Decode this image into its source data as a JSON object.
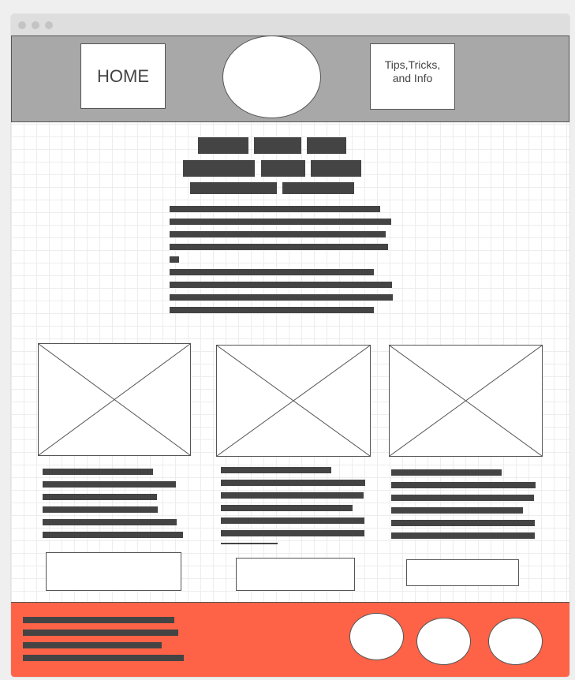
{
  "window": {
    "controls": [
      "close",
      "minimize",
      "maximize"
    ]
  },
  "header": {
    "nav_home_label": "HOME",
    "nav_tips_label": "Tips,Tricks,\nand Info",
    "logo_icon": "circle-logo-placeholder"
  },
  "colors": {
    "header_bg": "#a8a8a8",
    "footer_bg": "#ff6347",
    "text_bar": "#444444"
  },
  "cards": [
    {
      "image": "image-placeholder",
      "button": "button-placeholder"
    },
    {
      "image": "image-placeholder",
      "button": "button-placeholder"
    },
    {
      "image": "image-placeholder",
      "button": "button-placeholder"
    }
  ],
  "footer": {
    "social_icons": [
      "circle-icon",
      "circle-icon",
      "circle-icon"
    ]
  }
}
